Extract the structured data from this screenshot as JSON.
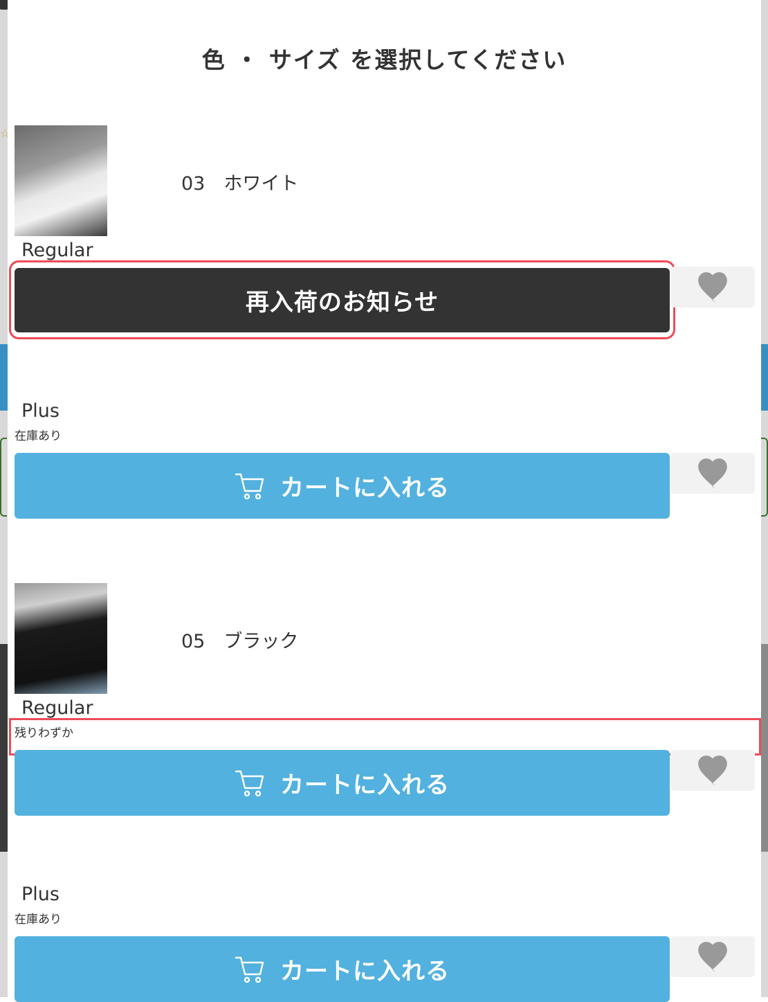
{
  "modal_title": "色 ・ サイズ を選択してください",
  "colors": [
    {
      "name": "03　ホワイト",
      "sizes": [
        {
          "size": "Regular",
          "stock": "",
          "button_label": "再入荷のお知らせ"
        },
        {
          "size": "Plus",
          "stock": "在庫あり",
          "button_label": "カートに入れる"
        }
      ]
    },
    {
      "name": "05　ブラック",
      "sizes": [
        {
          "size": "Regular",
          "stock": "残りわずか",
          "button_label": "カートに入れる"
        },
        {
          "size": "Plus",
          "stock": "在庫あり",
          "button_label": "カートに入れる"
        }
      ]
    }
  ],
  "accent_colors": {
    "cart_button": "#52b1de",
    "restock_button": "#333333",
    "highlight": "#ef4b56",
    "favorite_icon": "#999999"
  },
  "icons": [
    "cart-icon",
    "heart-icon"
  ]
}
